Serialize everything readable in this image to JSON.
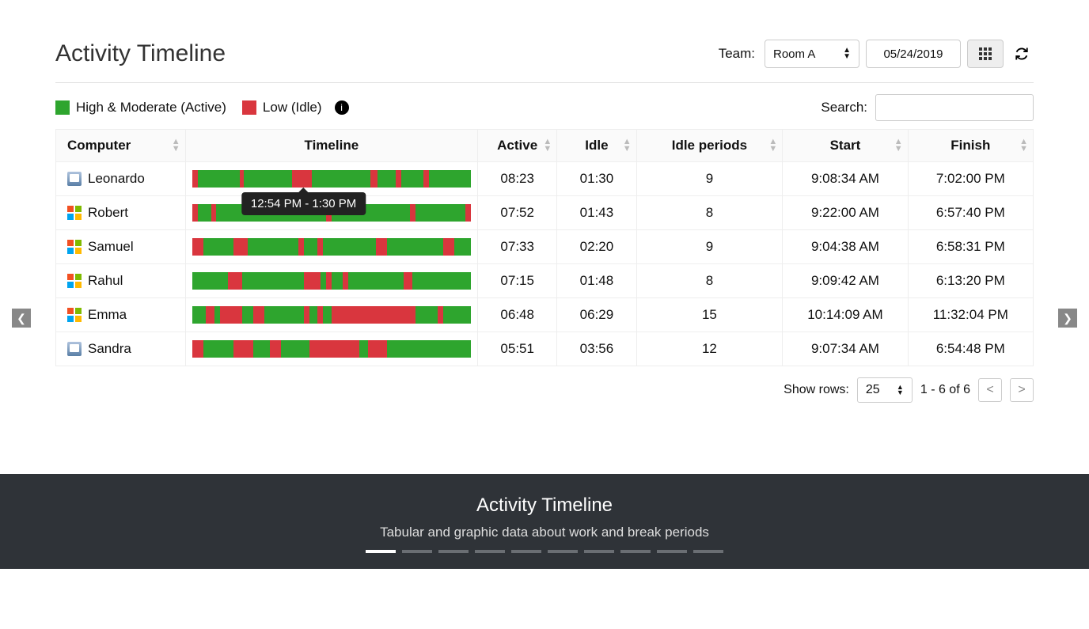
{
  "header": {
    "title": "Activity Timeline",
    "team_label": "Team:",
    "team_value": "Room A",
    "date_value": "05/24/2019"
  },
  "legend": {
    "high_label": "High & Moderate (Active)",
    "low_label": "Low (Idle)"
  },
  "search_label": "Search:",
  "columns": {
    "computer": "Computer",
    "timeline": "Timeline",
    "active": "Active",
    "idle": "Idle",
    "idle_periods": "Idle periods",
    "start": "Start",
    "finish": "Finish"
  },
  "tooltip": "12:54 PM - 1:30 PM",
  "rows": [
    {
      "os": "mac",
      "name": "Leonardo",
      "active": "08:23",
      "idle": "01:30",
      "periods": "9",
      "start": "9:08:34 AM",
      "finish": "7:02:00 PM",
      "segments": [
        [
          "idle",
          0,
          2
        ],
        [
          "active",
          2,
          17
        ],
        [
          "idle",
          17,
          18.5
        ],
        [
          "active",
          18.5,
          36
        ],
        [
          "idle",
          36,
          43
        ],
        [
          "active",
          43,
          64
        ],
        [
          "idle",
          64,
          66.5
        ],
        [
          "active",
          66.5,
          73
        ],
        [
          "idle",
          73,
          75
        ],
        [
          "active",
          75,
          83
        ],
        [
          "idle",
          83,
          85
        ],
        [
          "active",
          85,
          100
        ]
      ]
    },
    {
      "os": "win",
      "name": "Robert",
      "active": "07:52",
      "idle": "01:43",
      "periods": "8",
      "start": "9:22:00 AM",
      "finish": "6:57:40 PM",
      "segments": [
        [
          "idle",
          0,
          2
        ],
        [
          "active",
          2,
          7
        ],
        [
          "idle",
          7,
          8.5
        ],
        [
          "active",
          8.5,
          48
        ],
        [
          "idle",
          48,
          50
        ],
        [
          "active",
          50,
          78
        ],
        [
          "idle",
          78,
          80
        ],
        [
          "active",
          80,
          98
        ],
        [
          "idle",
          98,
          100
        ]
      ]
    },
    {
      "os": "win",
      "name": "Samuel",
      "active": "07:33",
      "idle": "02:20",
      "periods": "9",
      "start": "9:04:38 AM",
      "finish": "6:58:31 PM",
      "segments": [
        [
          "idle",
          0,
          4
        ],
        [
          "active",
          4,
          15
        ],
        [
          "idle",
          15,
          20
        ],
        [
          "active",
          20,
          38
        ],
        [
          "idle",
          38,
          40
        ],
        [
          "active",
          40,
          45
        ],
        [
          "idle",
          45,
          47
        ],
        [
          "active",
          47,
          66
        ],
        [
          "idle",
          66,
          70
        ],
        [
          "active",
          70,
          90
        ],
        [
          "idle",
          90,
          94
        ],
        [
          "active",
          94,
          100
        ]
      ]
    },
    {
      "os": "win",
      "name": "Rahul",
      "active": "07:15",
      "idle": "01:48",
      "periods": "8",
      "start": "9:09:42 AM",
      "finish": "6:13:20 PM",
      "segments": [
        [
          "active",
          0,
          13
        ],
        [
          "idle",
          13,
          18
        ],
        [
          "active",
          18,
          40
        ],
        [
          "idle",
          40,
          46
        ],
        [
          "active",
          46,
          48
        ],
        [
          "idle",
          48,
          50
        ],
        [
          "active",
          50,
          54
        ],
        [
          "idle",
          54,
          56
        ],
        [
          "active",
          56,
          76
        ],
        [
          "idle",
          76,
          79
        ],
        [
          "active",
          79,
          100
        ]
      ]
    },
    {
      "os": "win",
      "name": "Emma",
      "active": "06:48",
      "idle": "06:29",
      "periods": "15",
      "start": "10:14:09 AM",
      "finish": "11:32:04 PM",
      "segments": [
        [
          "active",
          0,
          5
        ],
        [
          "idle",
          5,
          8
        ],
        [
          "active",
          8,
          10
        ],
        [
          "idle",
          10,
          18
        ],
        [
          "active",
          18,
          22
        ],
        [
          "idle",
          22,
          26
        ],
        [
          "active",
          26,
          40
        ],
        [
          "idle",
          40,
          42
        ],
        [
          "active",
          42,
          45
        ],
        [
          "idle",
          45,
          47
        ],
        [
          "active",
          47,
          50
        ],
        [
          "idle",
          50,
          80
        ],
        [
          "active",
          80,
          88
        ],
        [
          "idle",
          88,
          90
        ],
        [
          "active",
          90,
          100
        ]
      ]
    },
    {
      "os": "mac",
      "name": "Sandra",
      "active": "05:51",
      "idle": "03:56",
      "periods": "12",
      "start": "9:07:34 AM",
      "finish": "6:54:48 PM",
      "segments": [
        [
          "idle",
          0,
          4
        ],
        [
          "active",
          4,
          15
        ],
        [
          "idle",
          15,
          22
        ],
        [
          "active",
          22,
          28
        ],
        [
          "idle",
          28,
          32
        ],
        [
          "active",
          32,
          42
        ],
        [
          "idle",
          42,
          60
        ],
        [
          "active",
          60,
          63
        ],
        [
          "idle",
          63,
          70
        ],
        [
          "active",
          70,
          100
        ]
      ]
    }
  ],
  "pager": {
    "show_rows_label": "Show rows:",
    "rows_value": "25",
    "range": "1 - 6 of 6"
  },
  "footer": {
    "title": "Activity Timeline",
    "subtitle": "Tabular and graphic data about work and break periods",
    "dot_count": 10,
    "active_dot": 0
  },
  "chart_data": {
    "type": "table",
    "description": "Per-computer activity timeline bars (green=active, red=idle) with durations",
    "rows": [
      {
        "computer": "Leonardo",
        "active": "08:23",
        "idle": "01:30",
        "idle_periods": 9,
        "start": "9:08:34 AM",
        "finish": "7:02:00 PM"
      },
      {
        "computer": "Robert",
        "active": "07:52",
        "idle": "01:43",
        "idle_periods": 8,
        "start": "9:22:00 AM",
        "finish": "6:57:40 PM"
      },
      {
        "computer": "Samuel",
        "active": "07:33",
        "idle": "02:20",
        "idle_periods": 9,
        "start": "9:04:38 AM",
        "finish": "6:58:31 PM"
      },
      {
        "computer": "Rahul",
        "active": "07:15",
        "idle": "01:48",
        "idle_periods": 8,
        "start": "9:09:42 AM",
        "finish": "6:13:20 PM"
      },
      {
        "computer": "Emma",
        "active": "06:48",
        "idle": "06:29",
        "idle_periods": 15,
        "start": "10:14:09 AM",
        "finish": "11:32:04 PM"
      },
      {
        "computer": "Sandra",
        "active": "05:51",
        "idle": "03:56",
        "idle_periods": 12,
        "start": "9:07:34 AM",
        "finish": "6:54:48 PM"
      }
    ]
  }
}
